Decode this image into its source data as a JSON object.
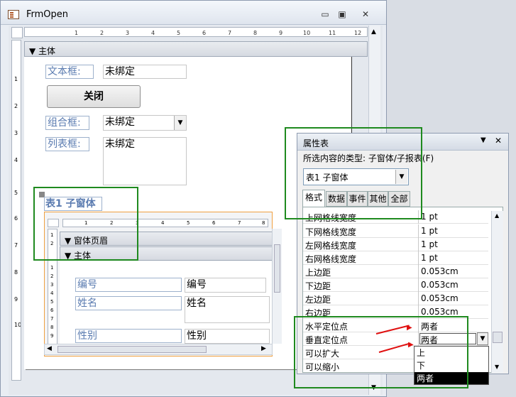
{
  "window": {
    "title": "FrmOpen",
    "buttons": {
      "minimize": "▭",
      "restore": "▣",
      "close": "✕"
    }
  },
  "ruler": {
    "h": [
      "1",
      "2",
      "3",
      "4",
      "5",
      "6",
      "7",
      "8",
      "9",
      "10",
      "11",
      "12"
    ],
    "v": [
      "1",
      "2",
      "3",
      "4",
      "5",
      "6",
      "7",
      "8",
      "9",
      "10"
    ],
    "sub_h": [
      "1",
      "2",
      "3",
      "4",
      "5",
      "6",
      "7",
      "8"
    ],
    "sub_v": [
      "1",
      "2",
      "1",
      "2",
      "3",
      "4",
      "5",
      "6",
      "7",
      "8",
      "9",
      "10"
    ]
  },
  "sections": {
    "main": "主体",
    "sub_header": "窗体页眉",
    "sub_main": "主体"
  },
  "controls": {
    "textbox_label": "文本框:",
    "textbox_value": "未绑定",
    "close_button": "关闭",
    "combo_label": "组合框:",
    "combo_value": "未绑定",
    "list_label": "列表框:",
    "list_value": "未绑定",
    "subform_label": "表1  子窗体"
  },
  "subform_fields": [
    {
      "label": "编号",
      "value": "编号"
    },
    {
      "label": "姓名",
      "value": "姓名"
    },
    {
      "label": "性别",
      "value": "性别"
    }
  ],
  "property_sheet": {
    "title": "属性表",
    "selection_type": "所选内容的类型: 子窗体/子报表(F)",
    "selected_object": "表1 子窗体",
    "tabs": [
      "格式",
      "数据",
      "事件",
      "其他",
      "全部"
    ],
    "rows": [
      {
        "name": "上网格线宽度",
        "value": "1 pt"
      },
      {
        "name": "下网格线宽度",
        "value": "1 pt"
      },
      {
        "name": "左网格线宽度",
        "value": "1 pt"
      },
      {
        "name": "右网格线宽度",
        "value": "1 pt"
      },
      {
        "name": "上边距",
        "value": "0.053cm"
      },
      {
        "name": "下边距",
        "value": "0.053cm"
      },
      {
        "name": "左边距",
        "value": "0.053cm"
      },
      {
        "name": "右边距",
        "value": "0.053cm"
      },
      {
        "name": "水平定位点",
        "value": "两者"
      },
      {
        "name": "垂直定位点",
        "value": "两者"
      },
      {
        "name": "可以扩大",
        "value": ""
      },
      {
        "name": "可以缩小",
        "value": ""
      }
    ],
    "dropdown_options": [
      "上",
      "下",
      "两者"
    ],
    "dropdown_selected": "两者"
  },
  "colors": {
    "annotation_green": "#1f8a1f",
    "annotation_red": "#e01010",
    "label_blue": "#5a7bb0"
  }
}
